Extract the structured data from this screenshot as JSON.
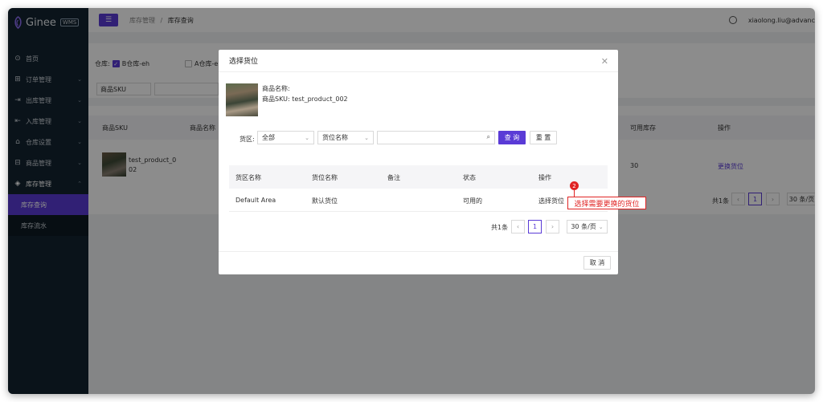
{
  "app": {
    "logo_text": "Ginee",
    "logo_badge": "WMS"
  },
  "sidebar": {
    "items": [
      {
        "label": "首页",
        "icon": "home-icon"
      },
      {
        "label": "订单管理",
        "icon": "cart-icon"
      },
      {
        "label": "出库管理",
        "icon": "outbound-icon"
      },
      {
        "label": "入库管理",
        "icon": "inbound-icon"
      },
      {
        "label": "仓库设置",
        "icon": "warehouse-icon"
      },
      {
        "label": "商品管理",
        "icon": "product-icon"
      },
      {
        "label": "库存管理",
        "icon": "inventory-icon"
      }
    ],
    "sub_items": [
      {
        "label": "库存查询",
        "active": true
      },
      {
        "label": "库存流水",
        "active": false
      }
    ]
  },
  "header": {
    "breadcrumb_parent": "库存管理",
    "breadcrumb_sep": "/",
    "breadcrumb_current": "库存查询",
    "username": "xiaolong.liu@advanc"
  },
  "background": {
    "warehouse_label": "仓库:",
    "warehouse_b": "B仓库-eh",
    "warehouse_a": "A仓库-e",
    "sku_select": "商品SKU",
    "col_sku": "商品SKU",
    "col_name": "商品名称",
    "col_available": "可用库存",
    "col_action": "操作",
    "row_sku": "test_product_002",
    "row_available": "30",
    "row_action": "更换货位",
    "total": "共1条",
    "page": "1",
    "page_size": "30 条/页"
  },
  "modal": {
    "title": "选择货位",
    "product_name_label": "商品名称:",
    "product_sku_label": "商品SKU:",
    "product_sku": "test_product_002",
    "area_label": "货区:",
    "area_select": "全部",
    "location_select": "货位名称",
    "search_placeholder": "",
    "search_button": "查 询",
    "reset_button": "重 置",
    "columns": [
      "货区名称",
      "货位名称",
      "备注",
      "状态",
      "操作"
    ],
    "rows": [
      {
        "area": "Default Area",
        "location": "默认货位",
        "note": "",
        "status": "可用的",
        "action": "选择货位"
      }
    ],
    "total": "共1条",
    "page": "1",
    "page_size": "30 条/页",
    "cancel_button": "取 消"
  },
  "annotation": {
    "step": "2",
    "text": "选择需要更换的货位"
  },
  "colors": {
    "primary": "#5a3bd6",
    "sidebar_bg": "#132330",
    "annotation": "#e02424"
  }
}
